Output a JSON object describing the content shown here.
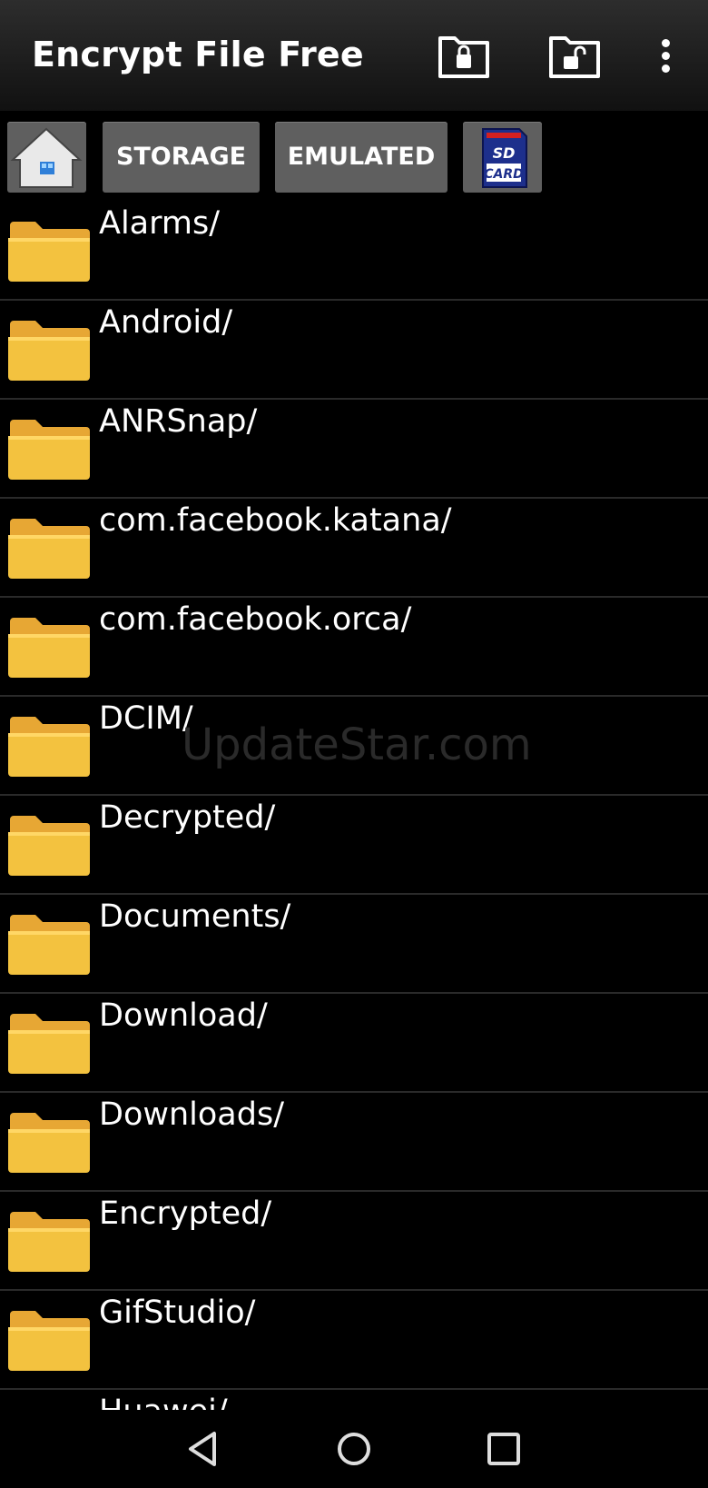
{
  "app": {
    "title": "Encrypt File Free"
  },
  "appbar": {
    "icons": [
      "encrypt-folder-icon",
      "decrypt-folder-icon",
      "overflow-menu-icon"
    ]
  },
  "toolbar": {
    "home_icon": "home-icon",
    "storage_label": "STORAGE",
    "emulated_label": "EMULATED",
    "sdcard_icon": "sd-card-icon",
    "sdcard_text_top": "SD",
    "sdcard_text_bottom": "CARD"
  },
  "files": [
    {
      "name": "Alarms/"
    },
    {
      "name": "Android/"
    },
    {
      "name": "ANRSnap/"
    },
    {
      "name": "com.facebook.katana/"
    },
    {
      "name": "com.facebook.orca/"
    },
    {
      "name": "DCIM/"
    },
    {
      "name": "Decrypted/"
    },
    {
      "name": "Documents/"
    },
    {
      "name": "Download/"
    },
    {
      "name": "Downloads/"
    },
    {
      "name": "Encrypted/"
    },
    {
      "name": "GifStudio/"
    },
    {
      "name": "Huawei/"
    }
  ],
  "watermark": "UpdateStar.com",
  "colors": {
    "background": "#000000",
    "folder": "#f3c23f",
    "folder_tab": "#e7a734",
    "button": "#5f5f5f"
  },
  "navbar": {
    "icons": [
      "back-icon",
      "home-circle-icon",
      "recents-icon"
    ]
  }
}
